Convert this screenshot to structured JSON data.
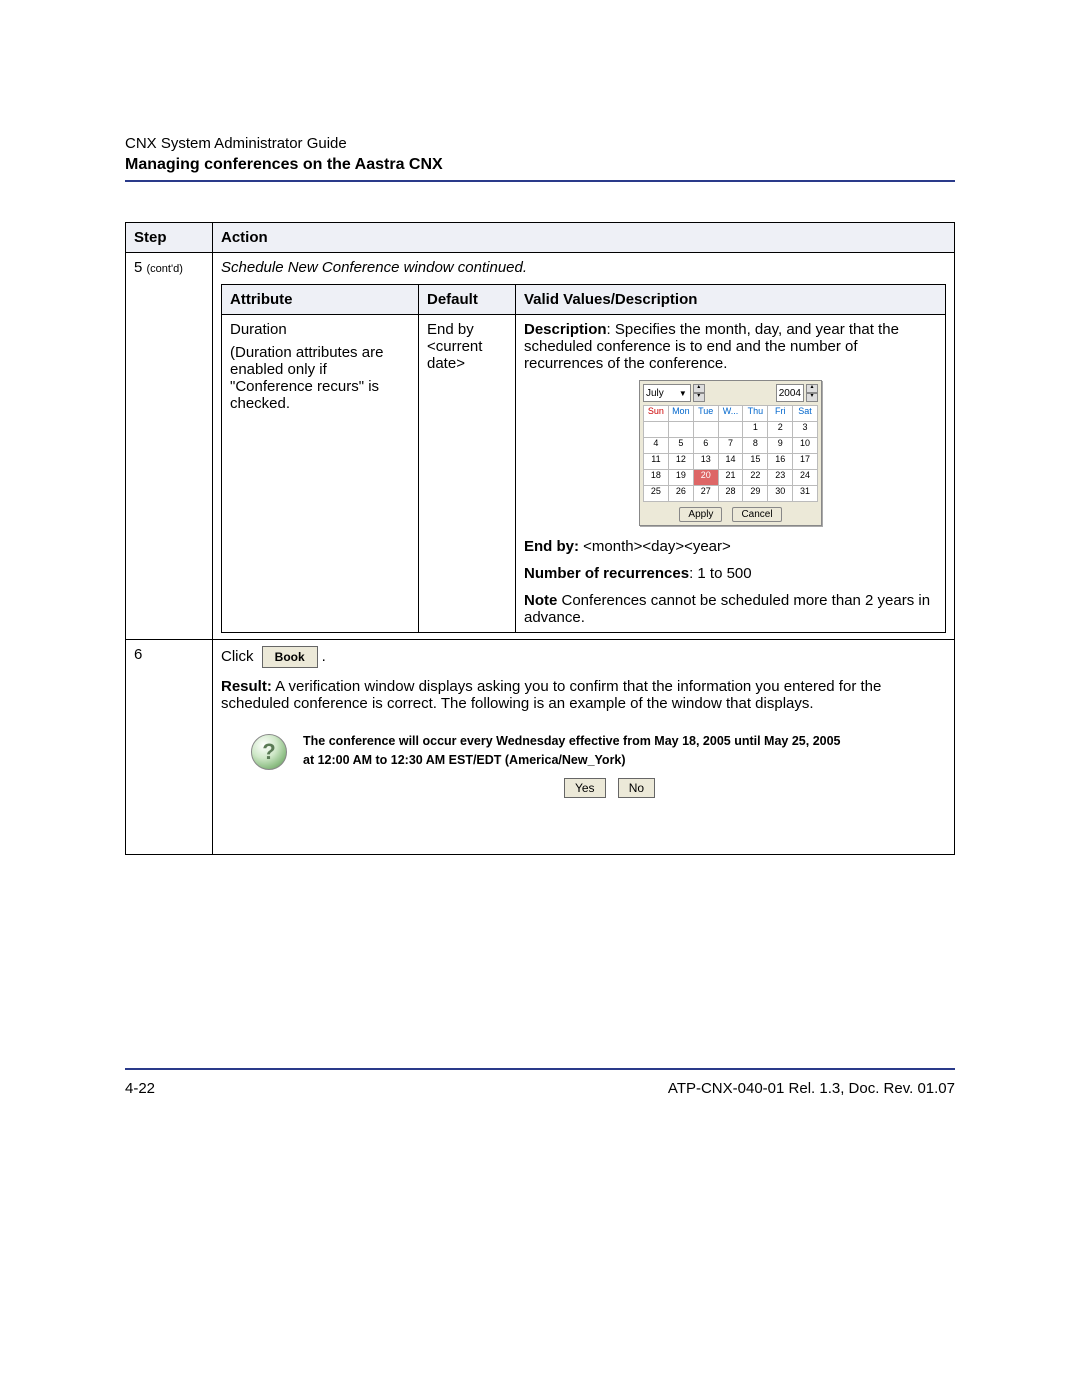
{
  "header": {
    "running": "CNX System Administrator Guide",
    "title": "Managing conferences on the Aastra CNX"
  },
  "footer": {
    "page": "4-22",
    "doc": "ATP-CNX-040-01 Rel. 1.3, Doc. Rev. 01.07"
  },
  "outer_headers": {
    "step": "Step",
    "action": "Action"
  },
  "step5": {
    "num": "5",
    "contd": "(cont'd)",
    "intro": "Schedule New Conference window continued.",
    "inner_headers": {
      "attr": "Attribute",
      "def": "Default",
      "val": "Valid Values/Description"
    },
    "row": {
      "attribute_name": "Duration",
      "attribute_note": "(Duration attributes are enabled only if \"Conference recurs\" is checked.",
      "default_val": "End by <current date>",
      "desc_label": "Description",
      "desc_text": ": Specifies the month, day, and year that the scheduled conference is to end and the number of recurrences of the conference.",
      "endby_label": "End by:",
      "endby_val": " <month><day><year>",
      "numrec_label": "Number of recurrences",
      "numrec_val": ": 1 to 500",
      "note_label": "Note",
      "note_text": " Conferences cannot be scheduled more than 2 years in advance."
    },
    "calendar": {
      "month": "July",
      "year": "2004",
      "dow": [
        "Sun",
        "Mon",
        "Tue",
        "W...",
        "Thu",
        "Fri",
        "Sat"
      ],
      "weeks": [
        [
          "",
          "",
          "",
          "",
          "1",
          "2",
          "3"
        ],
        [
          "4",
          "5",
          "6",
          "7",
          "8",
          "9",
          "10"
        ],
        [
          "11",
          "12",
          "13",
          "14",
          "15",
          "16",
          "17"
        ],
        [
          "18",
          "19",
          "20",
          "21",
          "22",
          "23",
          "24"
        ],
        [
          "25",
          "26",
          "27",
          "28",
          "29",
          "30",
          "31"
        ]
      ],
      "selected": "20",
      "apply": "Apply",
      "cancel": "Cancel"
    }
  },
  "step6": {
    "num": "6",
    "click": "Click",
    "book": "Book",
    "period": ".",
    "result_label": "Result:",
    "result_text": " A verification window displays asking you to confirm that the information you entered for the scheduled conference is correct. The following is an example of the window that displays.",
    "confirm_line1": "The conference will occur every Wednesday effective from May 18, 2005 until May 25, 2005",
    "confirm_line2": "at 12:00 AM to 12:30 AM EST/EDT (America/New_York)",
    "yes": "Yes",
    "no": "No"
  }
}
